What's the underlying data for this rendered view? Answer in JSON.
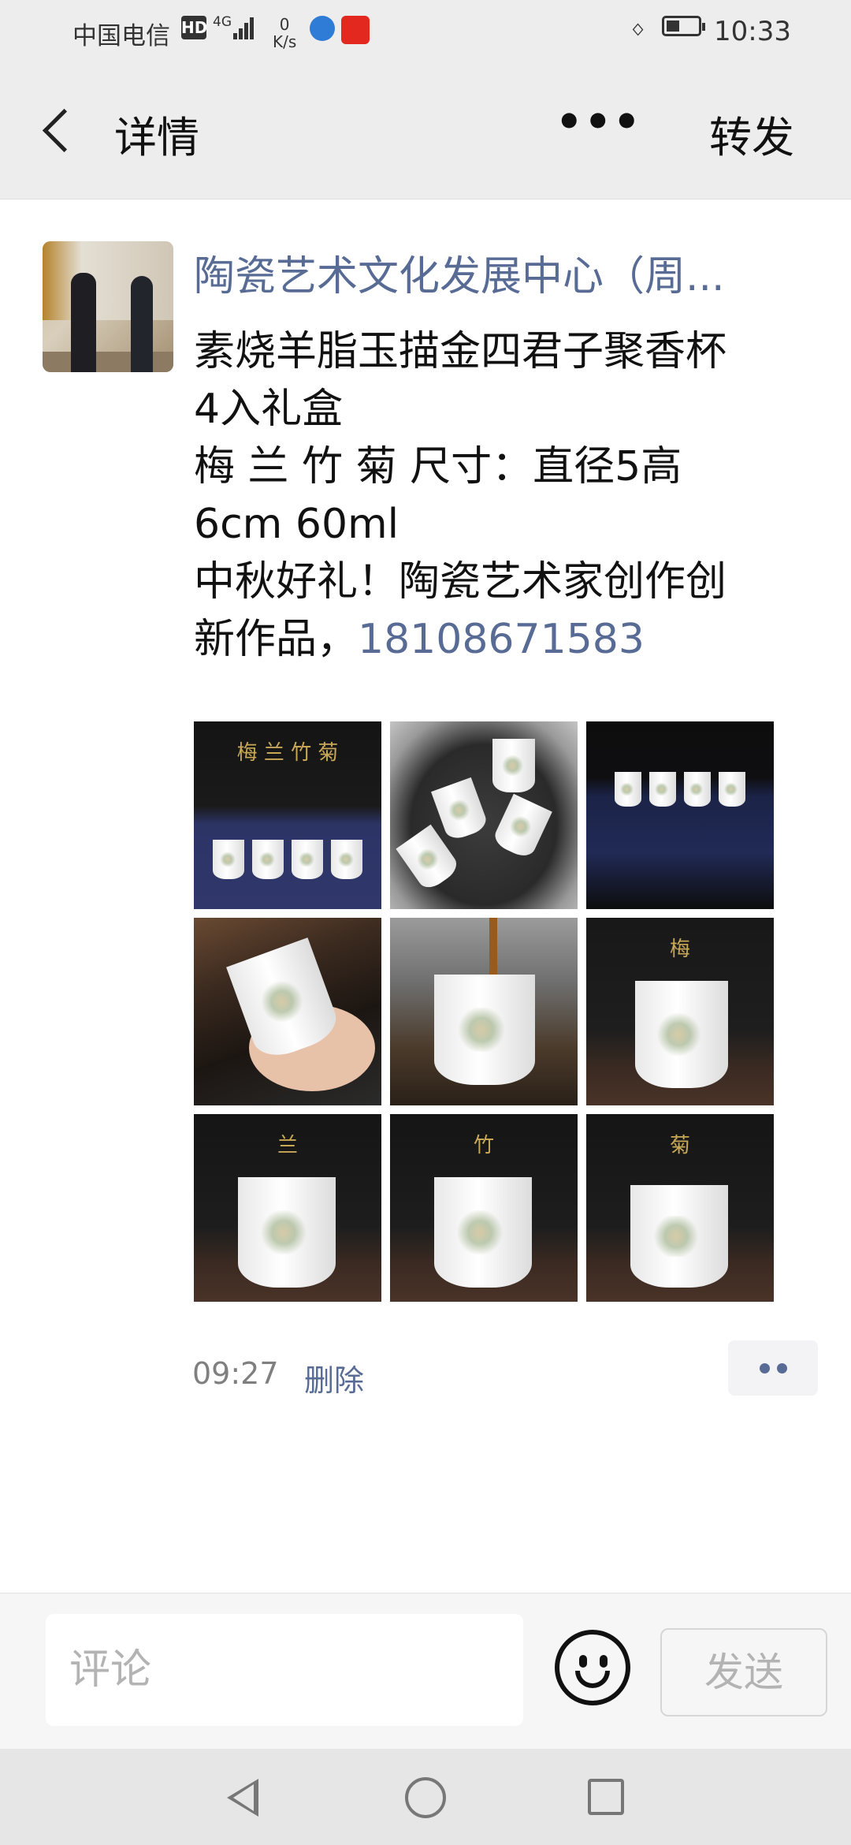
{
  "status_bar": {
    "carrier": "中国电信",
    "hd_badge": "HD",
    "network_type": "4G",
    "speed_value": "0",
    "speed_unit": "K/s",
    "bluetooth_icon": "bluetooth-icon",
    "time": "10:33"
  },
  "header": {
    "title": "详情",
    "more_icon": "more-dots-icon",
    "more_label": "•••",
    "forward_label": "转发"
  },
  "post": {
    "author": "陶瓷艺术文化发展中心（周...",
    "text_lines": [
      "素烧羊脂玉描金四君子聚香杯",
      "4入礼盒",
      "梅 兰 竹 菊 尺寸：直径5高",
      "6cm 60ml",
      "中秋好礼！陶瓷艺术家创作创"
    ],
    "last_line_prefix": "新作品，",
    "phone": "18108671583",
    "time": "09:27",
    "delete_label": "删除",
    "image_count": 9,
    "thumbnail_captions": [
      "梅 兰 竹 菊",
      "",
      "",
      "",
      "",
      "梅",
      "兰",
      "竹",
      "菊"
    ]
  },
  "comment_bar": {
    "placeholder": "评论",
    "send_label": "发送",
    "emoji_icon": "emoji-icon"
  },
  "nav_bar": {
    "back_icon": "nav-back-icon",
    "home_icon": "nav-home-icon",
    "recent_icon": "nav-recent-icon"
  }
}
